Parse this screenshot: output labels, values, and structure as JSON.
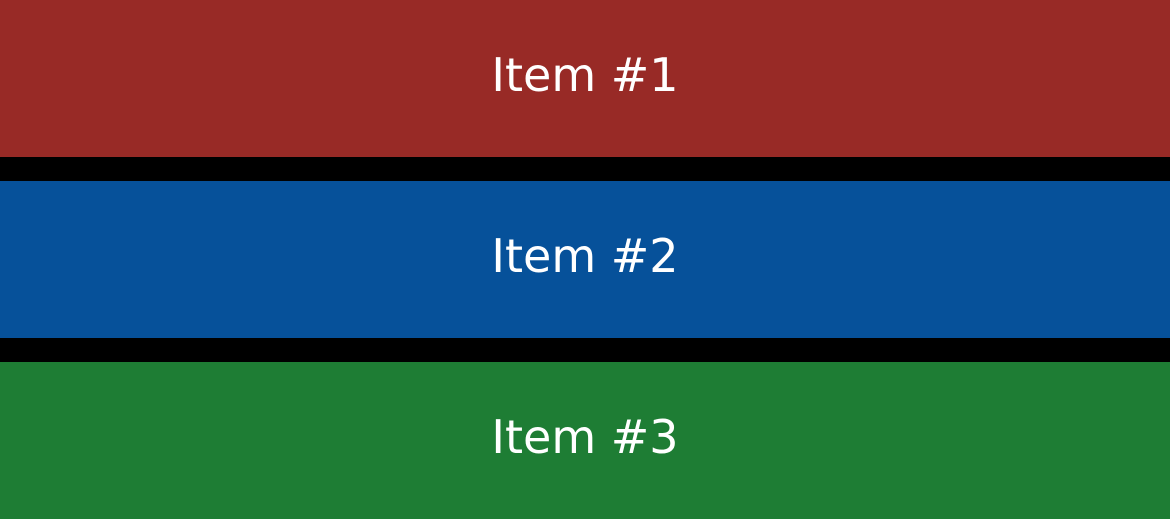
{
  "list": {
    "items": [
      {
        "label": "Item #1",
        "color": "#982a26"
      },
      {
        "label": "Item #2",
        "color": "#06519a"
      },
      {
        "label": "Item #3",
        "color": "#1e7d34"
      }
    ],
    "separator_color": "#000000"
  }
}
